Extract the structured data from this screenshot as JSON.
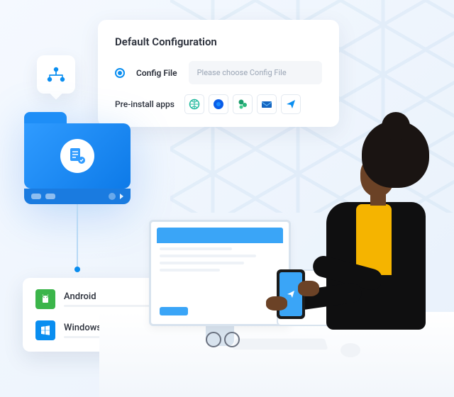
{
  "config": {
    "title": "Default Configuration",
    "file_label": "Config File",
    "file_placeholder": "Please choose Config File",
    "apps_label": "Pre-install apps",
    "apps": [
      {
        "name": "globe-app",
        "color": "#1db89c"
      },
      {
        "name": "browser-app",
        "color": "#0a5de8"
      },
      {
        "name": "sharepoint-app",
        "color": "#1a9c6b"
      },
      {
        "name": "mail-app",
        "color": "#1565c0"
      },
      {
        "name": "send-app",
        "color": "#0a8ef0"
      }
    ]
  },
  "os": {
    "items": [
      {
        "label": "Android",
        "kind": "android"
      },
      {
        "label": "Windows",
        "kind": "windows"
      }
    ]
  }
}
